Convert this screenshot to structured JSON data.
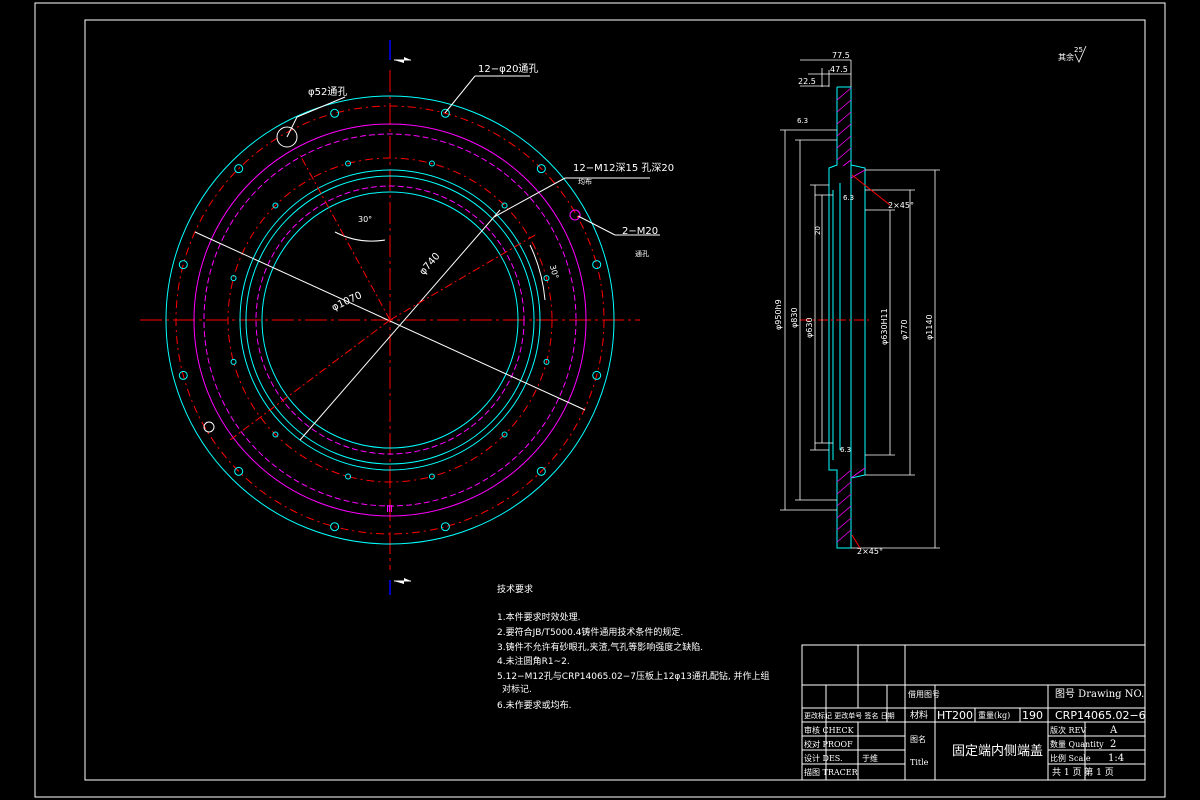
{
  "colors": {
    "background": "#000000",
    "frame": "#ffffff",
    "cyan": "#00ffff",
    "red": "#ff0000",
    "magenta": "#ff00ff",
    "white": "#ffffff"
  },
  "front_view": {
    "callouts": {
      "holes_12": "12−φ20通孔",
      "hole_52": "φ52通孔",
      "tapped_12": "12−M12深15  孔深20",
      "tapped_12_sub": "均布",
      "tapped_2": "2−M20",
      "tapped_2_sub": "通孔"
    },
    "dims": {
      "d1070": "φ1070",
      "d740": "φ740",
      "angle_a": "30°",
      "angle_b": "30°",
      "mark": "Ⅲ"
    }
  },
  "section_view": {
    "dims": {
      "top1": "77.5",
      "top2": "47.5",
      "top3": "22.5",
      "d950h9": "φ950h9",
      "d830": "φ830",
      "d630": "φ630",
      "d630h11": "φ630H11",
      "d770": "φ770",
      "d1140": "φ1140",
      "ch1": "2×45°",
      "ch2": "2×45°",
      "r1": "6.3",
      "r2": "6.3",
      "r3": "6.3",
      "note": "20"
    },
    "roughness_note": "其余"
  },
  "tech_requirements": {
    "title": "技术要求",
    "items": [
      "1.本件要求时效处理.",
      "2.要符合JB/T5000.4铸件通用技术条件的规定.",
      "3.铸件不允许有砂眼孔,夹渣,气孔等影响强度之缺陷.",
      "4.未注圆角R1~2.",
      "5.12−M12孔与CRP14065.02−7压板上12φ13通孔配钻, 并作上组",
      "对标记.",
      "6.未作要求或均布."
    ]
  },
  "title_block": {
    "drawing_no_label": "图号 Drawing NO.",
    "related_label": "借用图号",
    "material_label": "材料",
    "material_value": "HT200",
    "weight_label": "重量(kg)",
    "weight_value": "190",
    "drawing_no": "CRP14065.02−6",
    "rev_label": "版次 REV",
    "rev_value": "A",
    "qty_label": "数量 Quantity",
    "qty_value": "2",
    "scale_label": "比例 Scale",
    "scale_value": "1:4",
    "sheet_label": "共 1 页  第 1 页",
    "revision_header": "更改标记 更改单号 签名 日期",
    "check_label": "审核 CHECK",
    "proof_label": "校对 PROOF",
    "design_label": "设计 DES.",
    "designer_name": "于维",
    "tracer_label": "描图 TRACER",
    "name_label": "图名",
    "title_label": "Title",
    "title_value": "固定端内侧端盖"
  }
}
